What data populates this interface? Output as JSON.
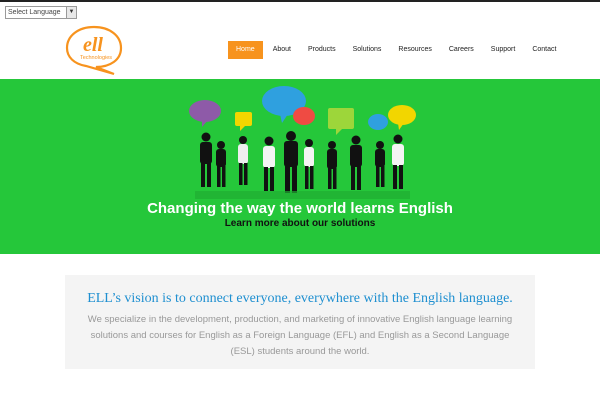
{
  "language_select": {
    "value": "Select Language"
  },
  "logo": {
    "wordmark": "ell",
    "tagline": "Technologies"
  },
  "nav": [
    {
      "label": "Home",
      "active": true
    },
    {
      "label": "About",
      "active": false
    },
    {
      "label": "Products",
      "active": false
    },
    {
      "label": "Solutions",
      "active": false
    },
    {
      "label": "Resources",
      "active": false
    },
    {
      "label": "Careers",
      "active": false
    },
    {
      "label": "Support",
      "active": false
    },
    {
      "label": "Contact",
      "active": false
    }
  ],
  "hero": {
    "title": "Changing the way the world learns English",
    "link": "Learn more about our solutions"
  },
  "vision": {
    "title": "ELL’s vision is to connect everyone, everywhere with the English language.",
    "text": "We specialize in the development, production, and marketing of innovative English language learning solutions and courses for English as a Foreign Language (EFL) and English as a Second Language (ESL) students around the world."
  },
  "colors": {
    "accent": "#f7931e",
    "hero_bg": "#25c73a",
    "vision_title": "#1e8fd0"
  }
}
